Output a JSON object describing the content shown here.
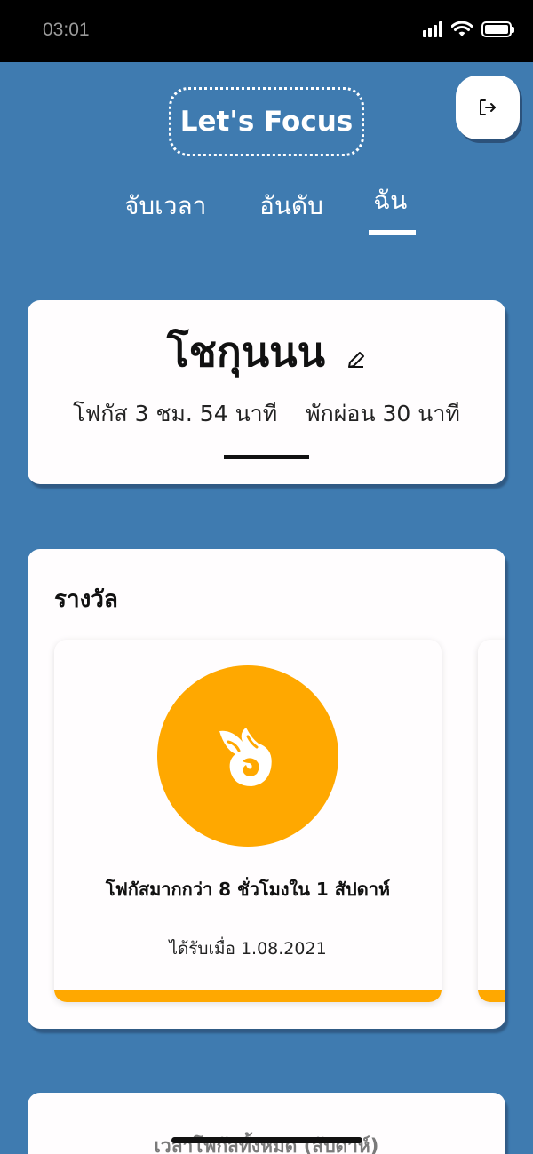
{
  "status_bar": {
    "time": "03:01"
  },
  "header": {
    "app_title": "Let's Focus"
  },
  "tabs": [
    {
      "label": "จับเวลา"
    },
    {
      "label": "อันดับ"
    },
    {
      "label": "ฉัน",
      "active": true
    }
  ],
  "profile": {
    "name": "โชกุนนน",
    "focus_text": "โฟกัส 3 ชม. 54 นาที",
    "rest_text": "พักผ่อน 30 นาที"
  },
  "rewards": {
    "heading": "รางวัล",
    "items": [
      {
        "icon": "fire-comet-icon",
        "title": "โฟกัสมากกว่า 8 ชั่วโมงใน 1 สัปดาห์",
        "date_text": "ได้รับเมื่อ 1.08.2021",
        "color": "#ffa800"
      }
    ]
  },
  "total": {
    "heading": "เวลาโฟกัสทั้งหมด (สัปดาห์)"
  },
  "colors": {
    "background": "#3f7bb0",
    "accent": "#ffa800",
    "card": "#fffdfe"
  }
}
